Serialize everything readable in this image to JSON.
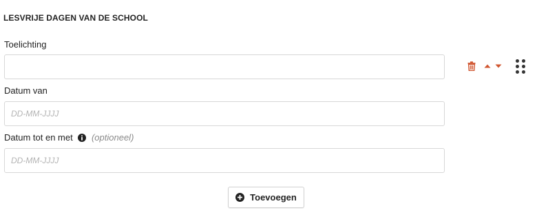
{
  "section": {
    "title": "LESVRIJE DAGEN VAN DE SCHOOL"
  },
  "fields": {
    "toelichting": {
      "label": "Toelichting",
      "value": "",
      "placeholder": ""
    },
    "datum_van": {
      "label": "Datum van",
      "value": "",
      "placeholder": "DD-MM-JJJJ"
    },
    "datum_tot": {
      "label": "Datum tot en met",
      "optional": "(optioneel)",
      "value": "",
      "placeholder": "DD-MM-JJJJ"
    }
  },
  "row_actions": {
    "icons": [
      "trash-icon",
      "arrow-up-icon",
      "arrow-down-icon",
      "drag-handle-icon"
    ],
    "accent_color": "#d0552f"
  },
  "add_button": {
    "label": "Toevoegen",
    "icon": "plus-circle-icon"
  }
}
